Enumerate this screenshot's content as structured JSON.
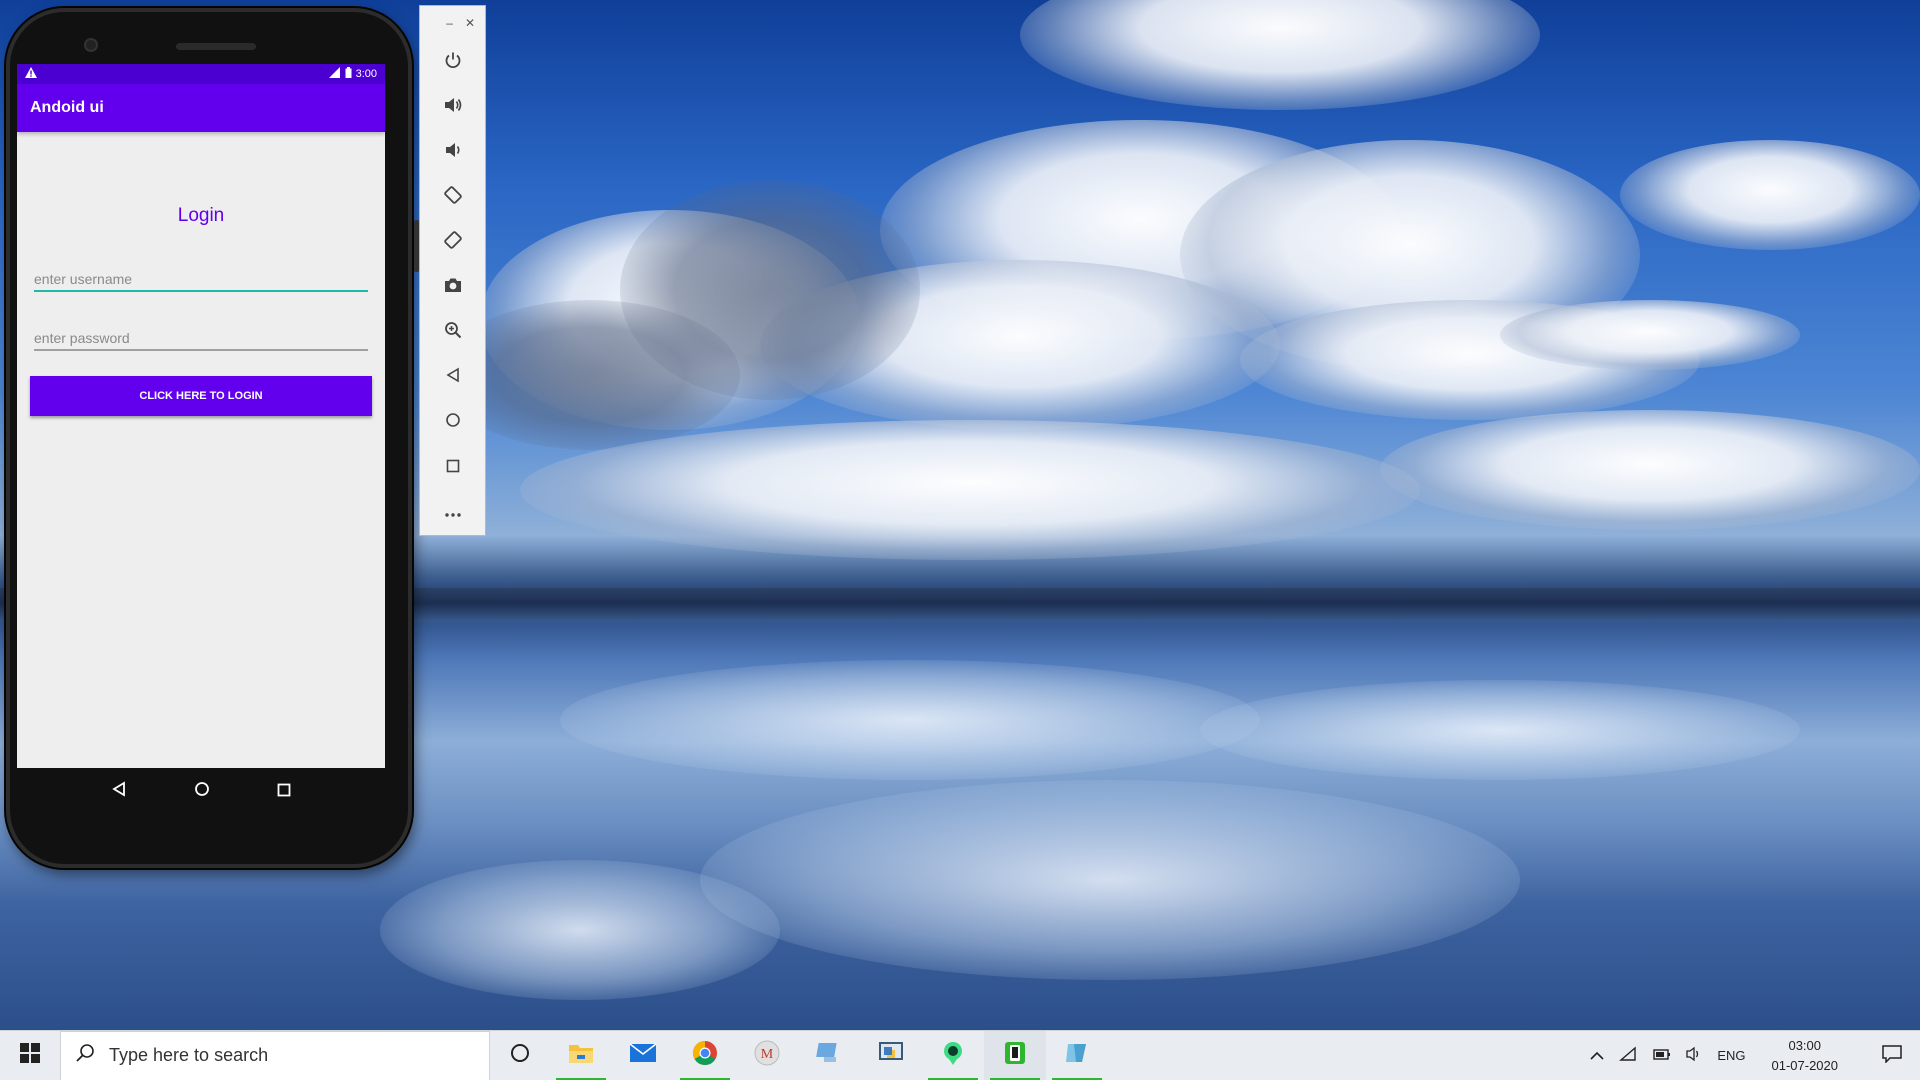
{
  "emulator": {
    "status_time": "3:00",
    "app_bar_title": "Andoid ui",
    "login_title": "Login",
    "username_placeholder": "enter username",
    "password_placeholder": "enter password",
    "login_button_label": "CLICK HERE TO LOGIN",
    "colors": {
      "primary": "#6200ee",
      "primary_dark": "#4b00d1",
      "accent": "#1fb8a6"
    },
    "nav_buttons": [
      "back-icon",
      "home-icon",
      "recents-icon"
    ]
  },
  "emulator_toolbar": {
    "window_buttons": [
      "minimize-icon",
      "close-icon"
    ],
    "tools": [
      "power-icon",
      "volume-up-icon",
      "volume-down-icon",
      "rotate-left-icon",
      "rotate-right-icon",
      "camera-icon",
      "zoom-icon",
      "back-icon",
      "home-icon",
      "overview-icon",
      "more-icon"
    ]
  },
  "taskbar": {
    "search_placeholder": "Type here to search",
    "pinned_apps": [
      "file-explorer-icon",
      "mail-icon",
      "chrome-icon",
      "gmail-icon",
      "connect-icon",
      "python-idle-icon",
      "android-studio-icon",
      "emulator-icon",
      "app-icon"
    ],
    "language": "ENG",
    "time": "03:00",
    "date": "01-07-2020"
  }
}
